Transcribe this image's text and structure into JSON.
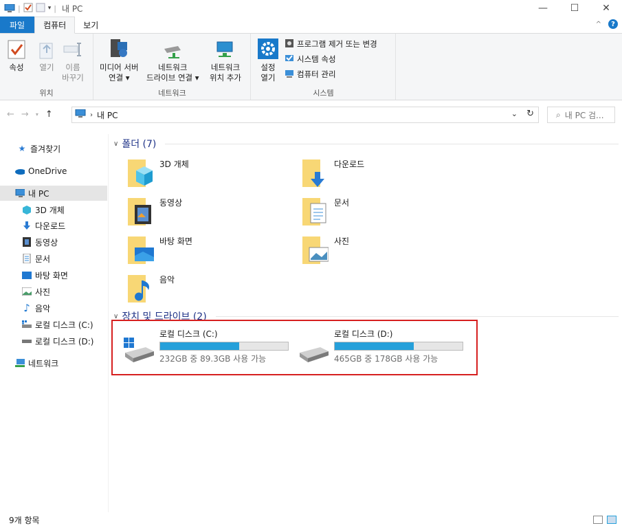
{
  "window": {
    "title": "내 PC",
    "controls": {
      "minimize": "—",
      "maximize": "☐",
      "close": "✕"
    }
  },
  "ribbon_tabs": [
    {
      "label": "파일"
    },
    {
      "label": "컴퓨터"
    },
    {
      "label": "보기"
    }
  ],
  "ribbon": {
    "location": {
      "label": "위치",
      "properties": "속성",
      "open": "열기",
      "rename_line1": "이름",
      "rename_line2": "바꾸기"
    },
    "network": {
      "label": "네트워크",
      "media_line1": "미디어 서버",
      "media_line2": "연결 ▾",
      "map_line1": "네트워크",
      "map_line2": "드라이브 연결 ▾",
      "add_line1": "네트워크",
      "add_line2": "위치 추가"
    },
    "system": {
      "label": "시스템",
      "settings_line1": "설정",
      "settings_line2": "열기",
      "uninstall": "프로그램 제거 또는 변경",
      "sys_props": "시스템 속성",
      "manage": "컴퓨터 관리"
    }
  },
  "address": {
    "path_label": "내 PC",
    "search_placeholder": "내 PC 검..."
  },
  "sidebar": {
    "items": [
      {
        "label": "즐겨찾기"
      },
      {
        "label": "OneDrive"
      },
      {
        "label": "내 PC"
      },
      {
        "label": "3D 개체"
      },
      {
        "label": "다운로드"
      },
      {
        "label": "동영상"
      },
      {
        "label": "문서"
      },
      {
        "label": "바탕 화면"
      },
      {
        "label": "사진"
      },
      {
        "label": "음악"
      },
      {
        "label": "로컬 디스크 (C:)"
      },
      {
        "label": "로컬 디스크 (D:)"
      },
      {
        "label": "네트워크"
      }
    ]
  },
  "folders_section": {
    "title": "폴더 (7)"
  },
  "folders": [
    {
      "label": "3D 개체"
    },
    {
      "label": "다운로드"
    },
    {
      "label": "동영상"
    },
    {
      "label": "문서"
    },
    {
      "label": "바탕 화면"
    },
    {
      "label": "사진"
    },
    {
      "label": "음악"
    }
  ],
  "drives_section": {
    "title": "장치 및 드라이브 (2)"
  },
  "drives": [
    {
      "name": "로컬 디스크 (C:)",
      "free_text": "232GB 중 89.3GB 사용 가능",
      "used_fraction": 0.62
    },
    {
      "name": "로컬 디스크 (D:)",
      "free_text": "465GB 중 178GB 사용 가능",
      "used_fraction": 0.62
    }
  ],
  "status": {
    "item_count": "9개 항목"
  },
  "colors": {
    "accent": "#1979ca",
    "drive_bar": "#26a0da",
    "highlight": "#d61f1f",
    "folder_yellow": "#f8d775"
  }
}
